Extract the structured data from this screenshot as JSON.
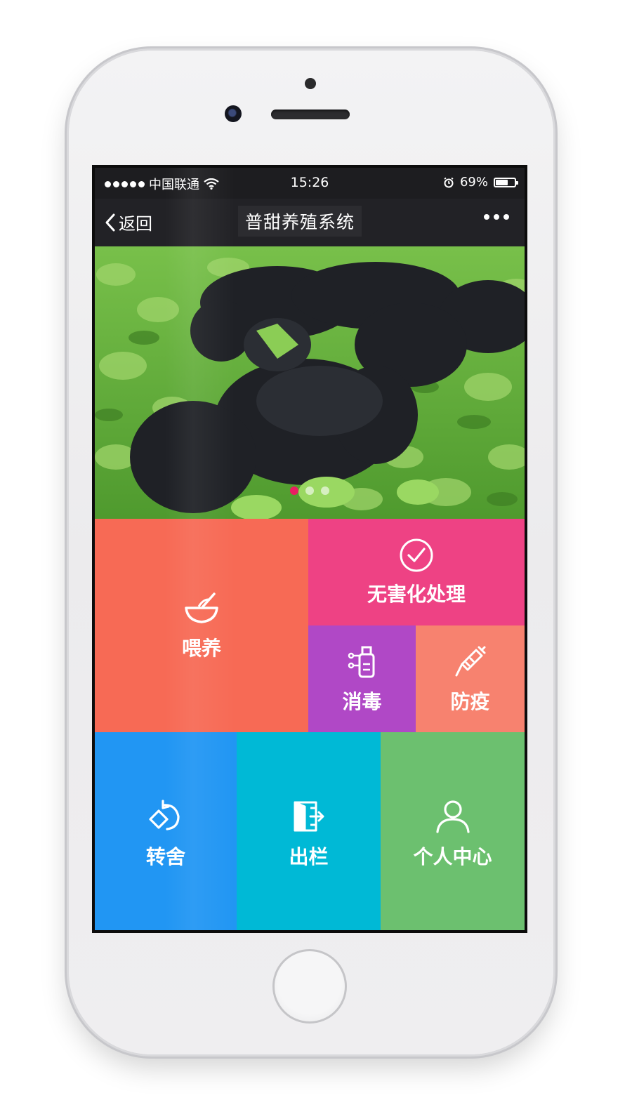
{
  "status_bar": {
    "carrier": "中国联通",
    "time": "15:26",
    "battery": "69%",
    "battery_level": 0.69
  },
  "nav": {
    "back_label": "返回",
    "title": "普甜养殖系统"
  },
  "banner": {
    "slide_count": 3,
    "active_index": 0
  },
  "tiles": {
    "feed": {
      "label": "喂养",
      "icon": "bowl-icon",
      "color": "#f76a55"
    },
    "harmless": {
      "label": "无害化处理",
      "icon": "check-circle-icon",
      "color": "#ee4284"
    },
    "disinfect": {
      "label": "消毒",
      "icon": "spray-bottle-icon",
      "color": "#b048c6"
    },
    "epidemic": {
      "label": "防疫",
      "icon": "syringe-icon",
      "color": "#f7826f"
    },
    "transfer": {
      "label": "转舍",
      "icon": "rotate-icon",
      "color": "#2196f3"
    },
    "outbound": {
      "label": "出栏",
      "icon": "door-exit-icon",
      "color": "#00b9d6"
    },
    "profile": {
      "label": "个人中心",
      "icon": "user-icon",
      "color": "#6cc06f"
    }
  }
}
